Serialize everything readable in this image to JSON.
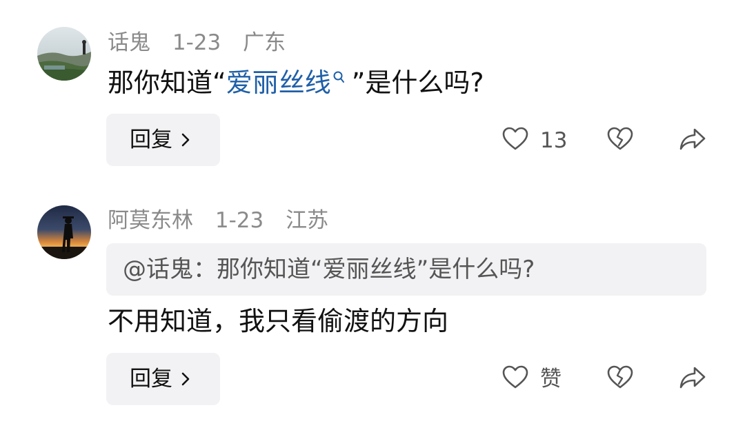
{
  "comments": [
    {
      "username": "话鬼",
      "date": "1-23",
      "location": "广东",
      "text_before_link": "那你知道“",
      "link_text": "爱丽丝线",
      "text_after_link": "”是什么吗?",
      "reply_label": "回复",
      "like_count": "13",
      "icons": [
        "heart-icon",
        "broken-heart-icon",
        "share-icon",
        "search-icon"
      ],
      "avatar": "outdoor-landscape-avatar"
    },
    {
      "username": "阿莫东林",
      "date": "1-23",
      "location": "江苏",
      "quote_text": "@话鬼：那你知道“爱丽丝线”是什么吗?",
      "text": "不用知道，我只看偷渡的方向",
      "reply_label": "回复",
      "like_label": "赞",
      "icons": [
        "heart-icon",
        "broken-heart-icon",
        "share-icon"
      ],
      "avatar": "sunset-silhouette-avatar"
    }
  ],
  "colors": {
    "text": "#111111",
    "meta": "#8a8a8a",
    "link": "#1f5fa8",
    "button_bg": "#f2f2f4",
    "icon": "#555555"
  }
}
